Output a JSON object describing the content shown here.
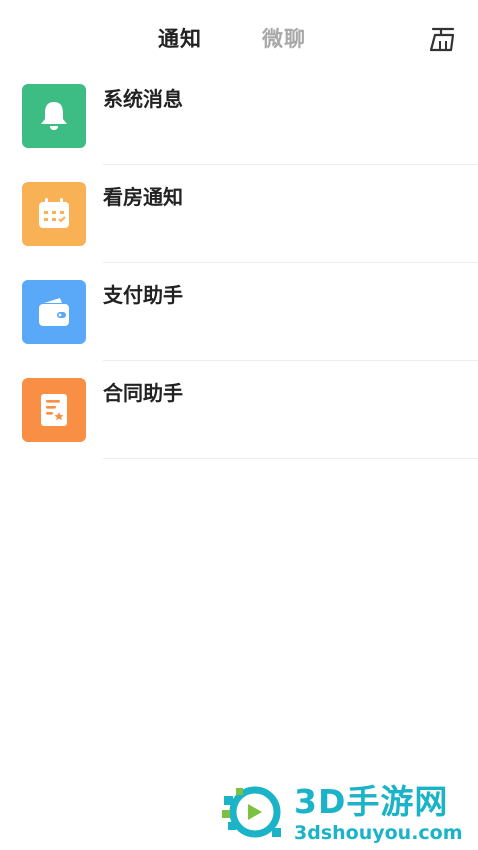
{
  "header": {
    "tabs": [
      {
        "label": "通知",
        "active": true
      },
      {
        "label": "微聊",
        "active": false
      }
    ],
    "clear_icon": "broom-icon"
  },
  "messages": [
    {
      "title": "系统消息",
      "icon": "bell-icon",
      "color": "#3dbd83"
    },
    {
      "title": "看房通知",
      "icon": "calendar-icon",
      "color": "#f9b155"
    },
    {
      "title": "支付助手",
      "icon": "wallet-icon",
      "color": "#5aa8f8"
    },
    {
      "title": "合同助手",
      "icon": "contract-icon",
      "color": "#f98e45"
    }
  ],
  "watermark": {
    "text": "3D手游网",
    "url": "3dshouyou.com"
  },
  "colors": {
    "tab_active": "#222222",
    "tab_inactive": "#a8a8a8",
    "watermark": "#1bb3c7"
  }
}
